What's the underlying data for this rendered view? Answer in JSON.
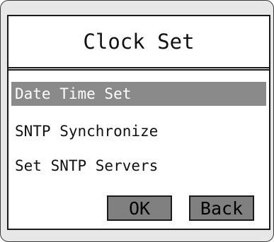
{
  "screen": {
    "title": "Clock Set",
    "menu_items": [
      {
        "label": "Date Time Set",
        "selected": true
      },
      {
        "label": "SNTP Synchronize",
        "selected": false
      },
      {
        "label": "Set SNTP Servers",
        "selected": false
      }
    ]
  },
  "buttons": {
    "ok_label": "OK",
    "back_label": "Back"
  },
  "colors": {
    "selection": "#8a8a8a",
    "button": "#808080",
    "bezel": "#e7e7e7"
  }
}
